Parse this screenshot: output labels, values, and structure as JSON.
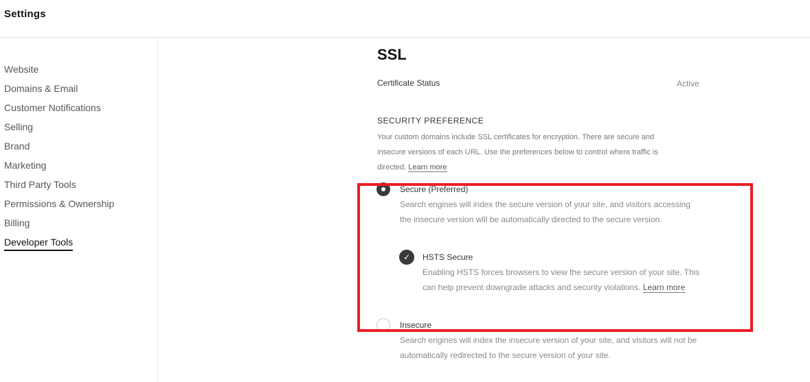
{
  "header": {
    "title": "Settings"
  },
  "sidebar": {
    "items": [
      {
        "label": "Website"
      },
      {
        "label": "Domains & Email"
      },
      {
        "label": "Customer Notifications"
      },
      {
        "label": "Selling"
      },
      {
        "label": "Brand"
      },
      {
        "label": "Marketing"
      },
      {
        "label": "Third Party Tools"
      },
      {
        "label": "Permissions & Ownership"
      },
      {
        "label": "Billing"
      },
      {
        "label": "Developer Tools",
        "active": true
      }
    ]
  },
  "main": {
    "title": "SSL",
    "certificate": {
      "label": "Certificate Status",
      "value": "Active"
    },
    "security": {
      "heading": "SECURITY PREFERENCE",
      "description": "Your custom domains include SSL certificates for encryption. There are secure and insecure versions of each URL. Use the preferences below to control where traffic is directed.",
      "learn_more": "Learn more",
      "options": [
        {
          "label": "Secure (Preferred)",
          "selected": true,
          "description": "Search engines will index the secure version of your site, and visitors accessing the insecure version will be automatically directed to the secure version."
        },
        {
          "label": "Insecure",
          "selected": false,
          "description": "Search engines will index the insecure version of your site, and visitors will not be automatically redirected to the secure version of your site."
        }
      ],
      "hsts": {
        "label": "HSTS Secure",
        "checked": true,
        "description": "Enabling HSTS forces browsers to view the secure version of your site. This can help prevent downgrade attacks and security violations.",
        "learn_more": "Learn more"
      }
    }
  },
  "annotation": {
    "highlight_color": "#ed1c24"
  }
}
